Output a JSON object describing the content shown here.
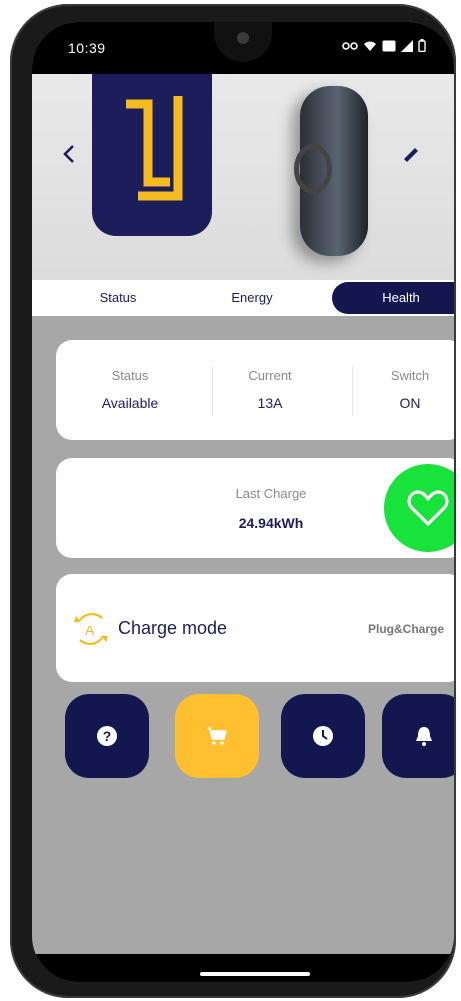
{
  "statusbar": {
    "time": "10:39"
  },
  "tabs": [
    "Status",
    "Energy",
    "Health"
  ],
  "status_card": [
    {
      "label": "Status",
      "value": "Available"
    },
    {
      "label": "Current",
      "value": "13A"
    },
    {
      "label": "Switch",
      "value": "ON"
    }
  ],
  "last_charge": {
    "label": "Last Charge",
    "value": "24.94kWh"
  },
  "charge_mode": {
    "label": "Charge mode",
    "value": "Plug&Charge"
  },
  "colors": {
    "navy": "#14174f",
    "yellow": "#ffbf2e",
    "green": "#17e33c"
  },
  "icons": {
    "back": "chevron-left-icon",
    "edit": "pencil-icon",
    "health": "heart-icon",
    "charge_mode": "auto-rotate-icon",
    "help": "question-icon",
    "cart": "cart-icon",
    "clock": "clock-icon",
    "bell": "bell-icon"
  }
}
